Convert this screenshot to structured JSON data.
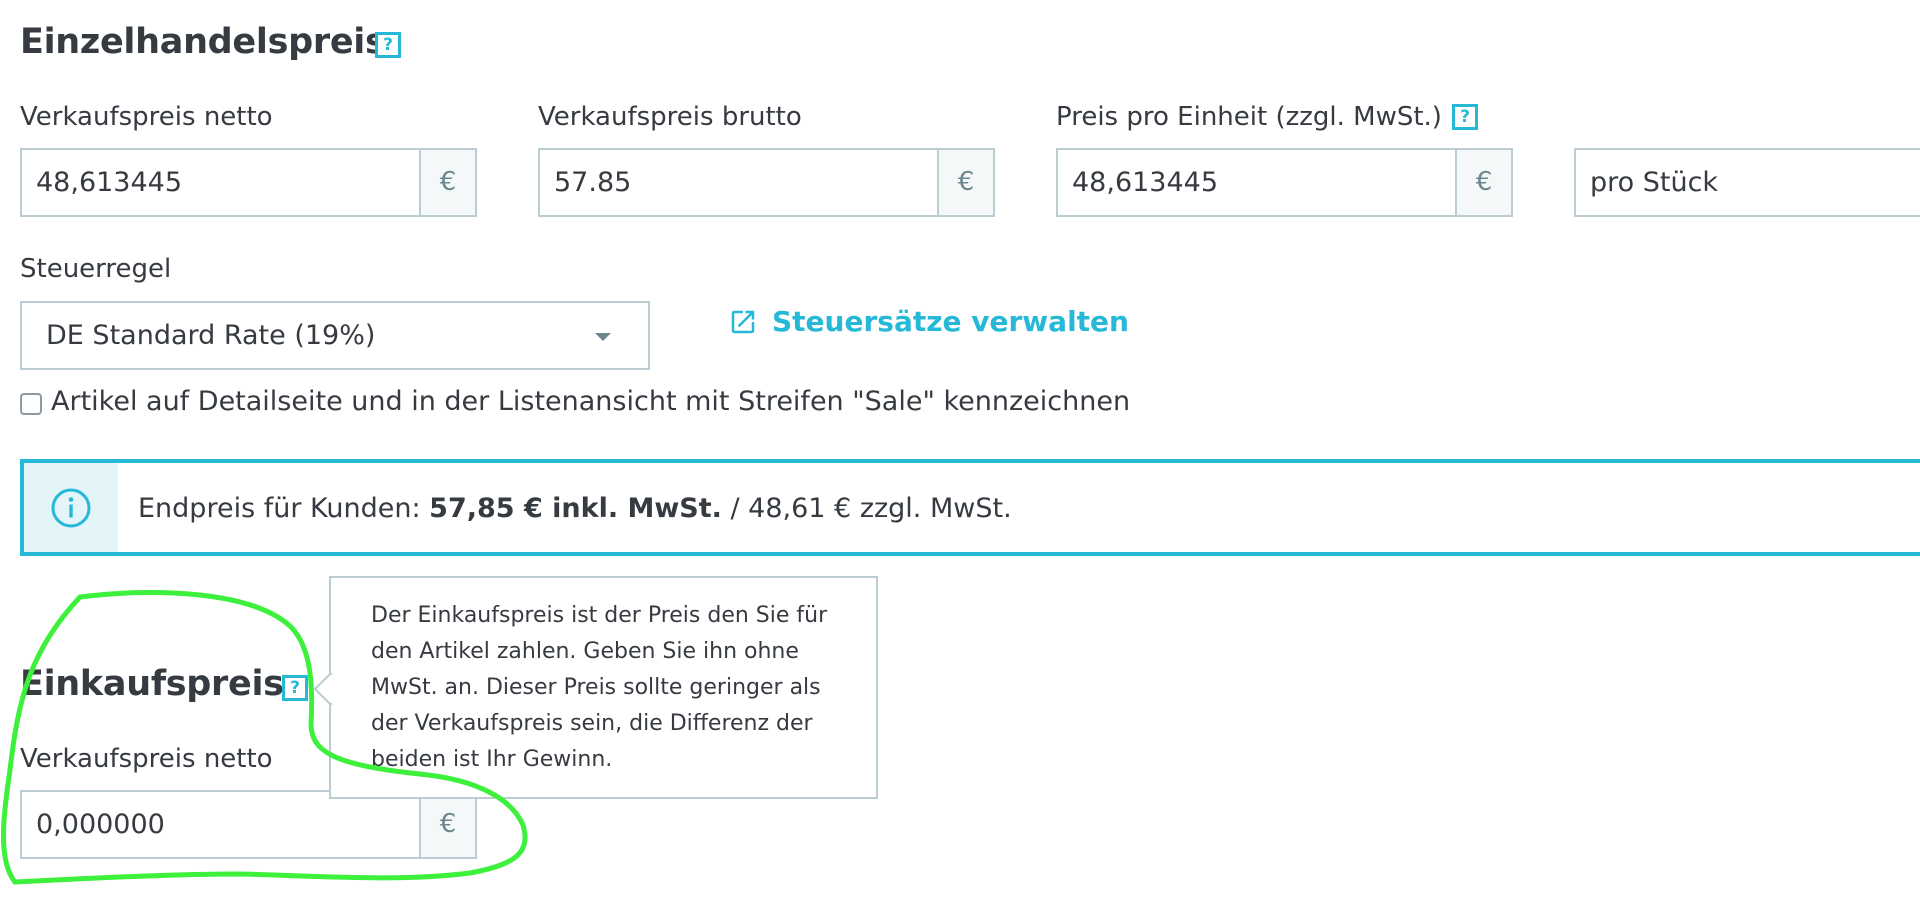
{
  "retail": {
    "title": "Einzelhandelspreis",
    "help_label": "?",
    "net_label": "Verkaufspreis netto",
    "net_value": "48,613445",
    "gross_label": "Verkaufspreis brutto",
    "gross_value": "57.85",
    "unit_price_label": "Preis pro Einheit (zzgl. MwSt.)",
    "unit_price_value": "48,613445",
    "unit_value": "pro Stück",
    "currency": "€"
  },
  "tax": {
    "label": "Steuerregel",
    "selected": "DE Standard Rate (19%)",
    "manage_link": "Steuersätze verwalten"
  },
  "sale_checkbox": {
    "label": "Artikel auf Detailseite und in der Listenansicht mit Streifen \"Sale\" kennzeichnen",
    "checked": false
  },
  "final_price": {
    "prefix": "Endpreis für Kunden: ",
    "gross": "57,85 € inkl. MwSt.",
    "net": " / 48,61 € zzgl. MwSt."
  },
  "purchase": {
    "title": "Einkaufspreis",
    "help_label": "?",
    "net_label": "Verkaufspreis netto",
    "net_value": "0,000000",
    "currency": "€"
  },
  "tooltip": {
    "lines": [
      "Der Einkaufspreis ist der Preis den Sie für",
      "den Artikel zahlen. Geben Sie ihn ohne",
      "MwSt. an. Dieser Preis sollte geringer als",
      "der Verkaufspreis sein, die Differenz der",
      "beiden ist Ihr Gewinn."
    ]
  },
  "colors": {
    "accent": "#25b9d7",
    "border": "#bbcdd2",
    "annotation": "#3cf03c"
  }
}
